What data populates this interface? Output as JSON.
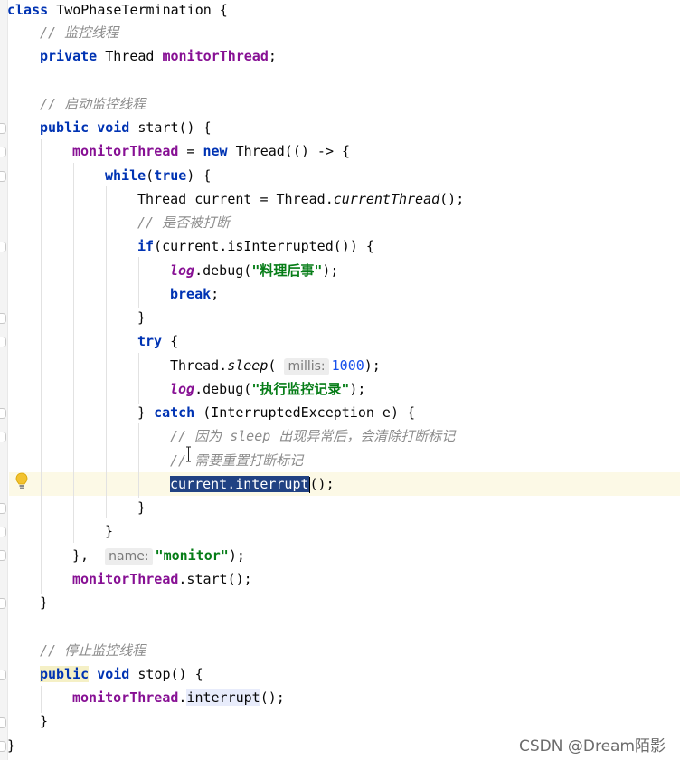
{
  "editor": {
    "class_decl": {
      "kw": "class",
      "name": "TwoPhaseTermination",
      "brace": " {"
    },
    "comment_monitor": "// 监控线程",
    "field_decl": {
      "kw": "private",
      "type": " Thread ",
      "name": "monitorThread",
      "end": ";"
    },
    "comment_start": "// 启动监控线程",
    "start_decl": {
      "kw1": "public",
      "kw2": "void",
      "sig": " start() {"
    },
    "assign": {
      "field": "monitorThread",
      "op": " = ",
      "kw": "new",
      "rest": " Thread(() -> {"
    },
    "while_line": {
      "kw1": "while",
      "open": "(",
      "kw2": "true",
      "rest": ") {"
    },
    "current_line": {
      "prefix": "Thread current = Thread.",
      "method": "currentThread",
      "rest": "();"
    },
    "comment_interrupted": "// 是否被打断",
    "if_line": {
      "kw": "if",
      "rest": "(current.isInterrupted()) {"
    },
    "debug1": {
      "log": "log",
      "call": ".debug(",
      "str": "\"料理后事\"",
      "end": ");"
    },
    "break_line": {
      "kw": "break",
      "end": ";"
    },
    "close_brace": "}",
    "try_line": {
      "kw": "try",
      "rest": " {"
    },
    "sleep_line": {
      "prefix": "Thread.",
      "method": "sleep",
      "open": "(",
      "hint": "millis:",
      "num": "1000",
      "end": ");"
    },
    "debug2": {
      "log": "log",
      "call": ".debug(",
      "str": "\"执行监控记录\"",
      "end": ");"
    },
    "catch_line": {
      "brace": "} ",
      "kw": "catch",
      "rest": " (InterruptedException e) {"
    },
    "comment_reason": "// 因为 sleep 出现异常后，会清除打断标记",
    "comment_reset": "// 需要重置打断标记",
    "interrupt_line": {
      "selected": "current.interrupt",
      "end": "();"
    },
    "thread_close": {
      "prefix": "},",
      "hint": "name:",
      "str": "\"monitor\"",
      "end": ");"
    },
    "start_call": {
      "field": "monitorThread",
      "rest": ".start();"
    },
    "comment_stop": "// 停止监控线程",
    "stop_decl": {
      "kw1": "public",
      "kw2": "void",
      "sig": " stop() {"
    },
    "stop_body": {
      "field": "monitorThread",
      "dot": ".",
      "method": "interrupt",
      "end": "();"
    }
  },
  "watermark": "CSDN @Dream陌影",
  "colors": {
    "keyword": "#0033b3",
    "field": "#871094",
    "string": "#067d17",
    "comment": "#8c8c8c",
    "number": "#1750eb",
    "selection": "#214283"
  },
  "icons": [
    "lightbulb-icon",
    "fold-marker-icon",
    "text-cursor-icon"
  ]
}
